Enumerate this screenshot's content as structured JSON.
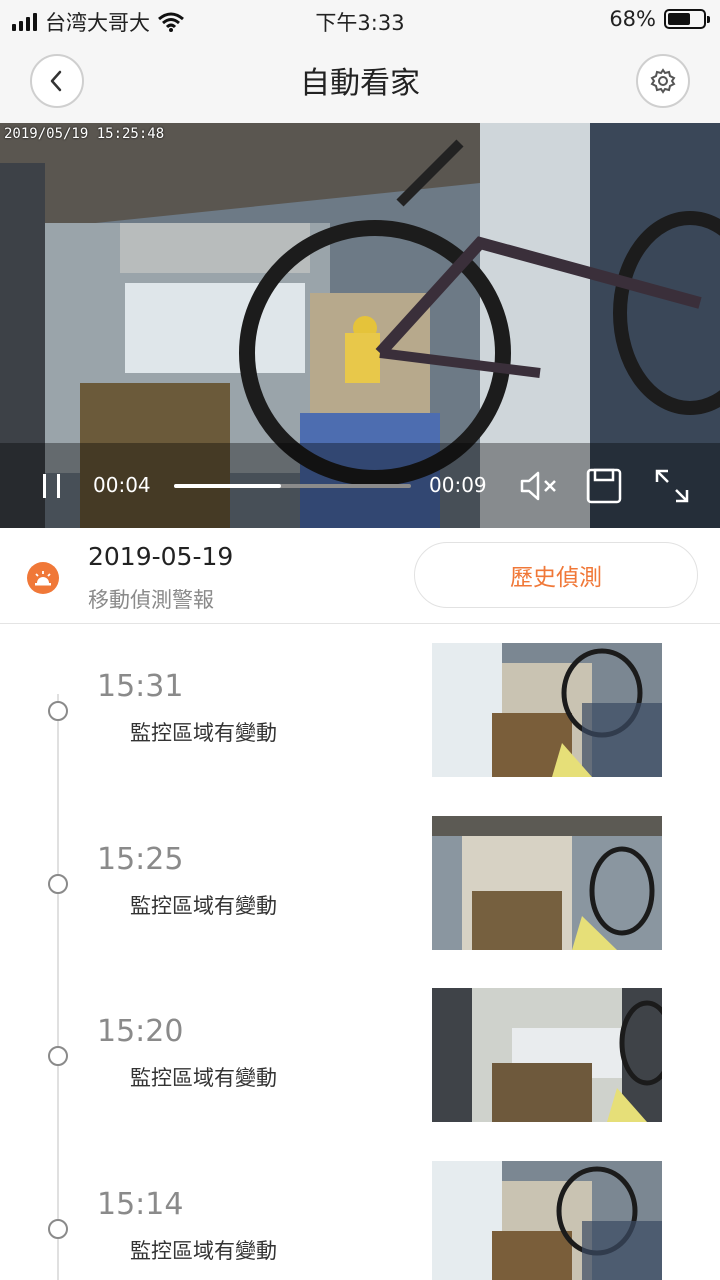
{
  "status_bar": {
    "carrier": "台湾大哥大",
    "time": "下午3:33",
    "battery_percent": "68%",
    "battery_level": 0.68
  },
  "navbar": {
    "title": "自動看家",
    "back_icon": "chevron-left-icon",
    "settings_icon": "gear-icon"
  },
  "video": {
    "timestamp": "2019/05/19  15:25:48",
    "current_time": "00:04",
    "total_time": "00:09",
    "progress": 0.45,
    "pause_icon": "pause-icon",
    "mute_icon": "speaker-muted-icon",
    "save_icon": "save-icon",
    "fullscreen_icon": "fullscreen-icon"
  },
  "alert_header": {
    "date": "2019-05-19",
    "type": "移動偵測警報",
    "history_button": "歷史偵測",
    "accent_color": "#f07838"
  },
  "events": [
    {
      "time": "15:31",
      "label": "監控區域有變動"
    },
    {
      "time": "15:25",
      "label": "監控區域有變動"
    },
    {
      "time": "15:20",
      "label": "監控區域有變動"
    },
    {
      "time": "15:14",
      "label": "監控區域有變動"
    }
  ]
}
